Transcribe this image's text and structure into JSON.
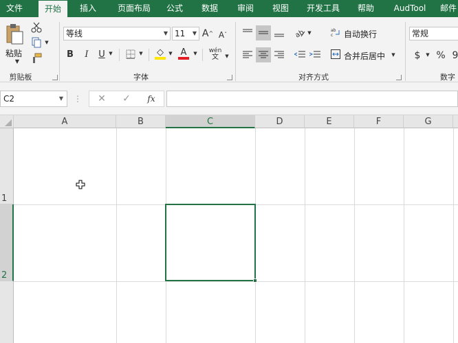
{
  "tabs": [
    "文件",
    "开始",
    "插入",
    "页面布局",
    "公式",
    "数据",
    "审阅",
    "视图",
    "开发工具",
    "帮助",
    "AudTool",
    "邮件"
  ],
  "ribbon": {
    "clipboard": {
      "paste_label": "粘贴",
      "group_label": "剪贴板"
    },
    "font": {
      "font_name": "等线",
      "font_size": "11",
      "bold": "B",
      "italic": "I",
      "underline": "U",
      "grow": "A",
      "shrink": "A",
      "fill_glyph": "◇",
      "font_color_glyph": "A",
      "phonetic_top": "wén",
      "phonetic_bottom": "文",
      "group_label": "字体"
    },
    "alignment": {
      "wrap_text": "自动换行",
      "merge_center": "合并后居中",
      "group_label": "对齐方式"
    },
    "number": {
      "format": "常规",
      "currency": "$",
      "percent": "%",
      "comma": "9",
      "group_label": "数字"
    }
  },
  "formula_bar": {
    "name_box": "C2",
    "formula": "",
    "cancel": "✕",
    "enter": "✓",
    "fx": "fx"
  },
  "sheet": {
    "columns": [
      "A",
      "B",
      "C",
      "D",
      "E",
      "F",
      "G"
    ],
    "rows": [
      "1",
      "2"
    ],
    "selected_cell": "C2"
  },
  "colors": {
    "accent": "#217346",
    "ribbon_bg": "#f3f3f3",
    "header_bg": "#e6e6e6",
    "fill_yellow": "#ffe600",
    "font_red": "#e51c23"
  }
}
